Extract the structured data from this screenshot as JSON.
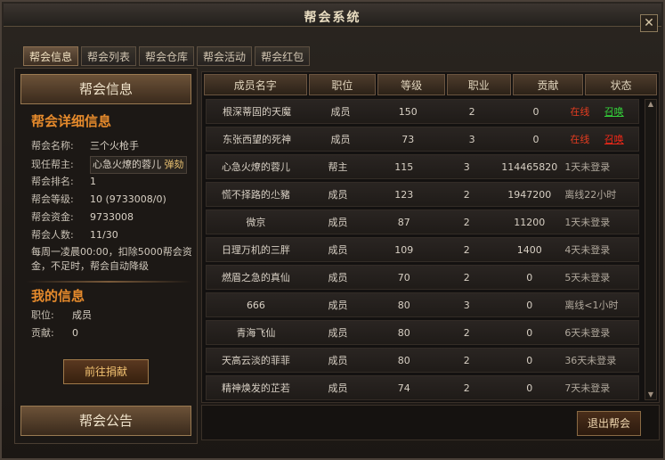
{
  "window": {
    "title": "帮会系统",
    "close": "✕"
  },
  "tabs": [
    "帮会信息",
    "帮会列表",
    "帮会仓库",
    "帮会活动",
    "帮会红包"
  ],
  "left": {
    "header": "帮会信息",
    "detail_title": "帮会详细信息",
    "fields": [
      {
        "key": "帮会名称:",
        "value": "三个火枪手"
      },
      {
        "key": "现任帮主:",
        "value": "心急火燎的蓉儿",
        "action": "弹劾"
      },
      {
        "key": "帮会排名:",
        "value": "1"
      },
      {
        "key": "帮会等级:",
        "value": "10 (9733008/0)"
      },
      {
        "key": "帮会资金:",
        "value": "9733008"
      },
      {
        "key": "帮会人数:",
        "value": "11/30"
      }
    ],
    "notice": "每周一凌晨00:00，扣除5000帮会资金，不足时，帮会自动降级",
    "my_title": "我的信息",
    "my_fields": [
      {
        "key": "职位:",
        "value": "成员"
      },
      {
        "key": "贡献:",
        "value": "0"
      }
    ],
    "donate_button": "前往捐献",
    "announce_header": "帮会公告"
  },
  "table": {
    "headers": [
      "成员名字",
      "职位",
      "等级",
      "职业",
      "贡献",
      "状态"
    ],
    "rows": [
      {
        "name": "根深蒂固的天魔",
        "role": "成员",
        "level": "150",
        "job": "2",
        "contrib": "0",
        "status": "在线",
        "action": "召唤",
        "online": true,
        "action_color": "green"
      },
      {
        "name": "东张西望的死神",
        "role": "成员",
        "level": "73",
        "job": "3",
        "contrib": "0",
        "status": "在线",
        "action": "召唤",
        "online": true,
        "action_color": "red"
      },
      {
        "name": "心急火燎的蓉儿",
        "role": "帮主",
        "level": "115",
        "job": "3",
        "contrib": "114465820",
        "status": "1天未登录",
        "action": "",
        "online": false
      },
      {
        "name": "慌不择路的尐豬",
        "role": "成员",
        "level": "123",
        "job": "2",
        "contrib": "1947200",
        "status": "离线22小时",
        "action": "",
        "online": false
      },
      {
        "name": "微京",
        "role": "成员",
        "level": "87",
        "job": "2",
        "contrib": "11200",
        "status": "1天未登录",
        "action": "",
        "online": false
      },
      {
        "name": "日理万机的三胖",
        "role": "成员",
        "level": "109",
        "job": "2",
        "contrib": "1400",
        "status": "4天未登录",
        "action": "",
        "online": false
      },
      {
        "name": "燃眉之急的真仙",
        "role": "成员",
        "level": "70",
        "job": "2",
        "contrib": "0",
        "status": "5天未登录",
        "action": "",
        "online": false
      },
      {
        "name": "666",
        "role": "成员",
        "level": "80",
        "job": "3",
        "contrib": "0",
        "status": "离线<1小时",
        "action": "",
        "online": false
      },
      {
        "name": "青海飞仙",
        "role": "成员",
        "level": "80",
        "job": "2",
        "contrib": "0",
        "status": "6天未登录",
        "action": "",
        "online": false
      },
      {
        "name": "天高云淡的菲菲",
        "role": "成员",
        "level": "80",
        "job": "2",
        "contrib": "0",
        "status": "36天未登录",
        "action": "",
        "online": false
      },
      {
        "name": "精神焕发的芷若",
        "role": "成员",
        "level": "74",
        "job": "2",
        "contrib": "0",
        "status": "7天未登录",
        "action": "",
        "online": false
      }
    ]
  },
  "exit_button": "退出帮会"
}
